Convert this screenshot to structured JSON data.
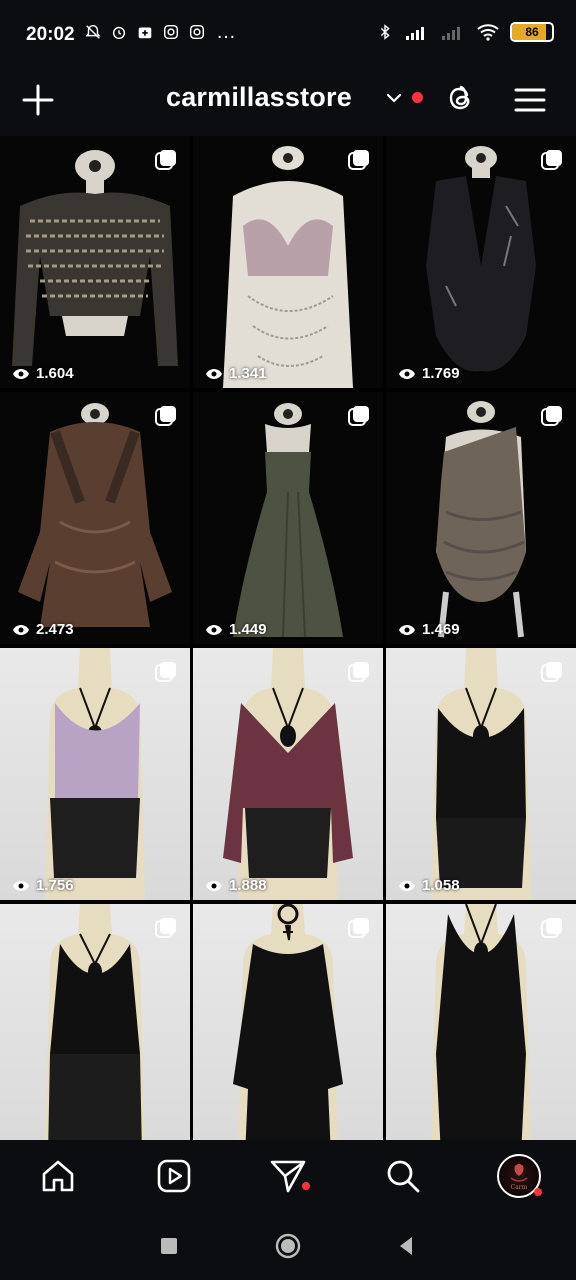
{
  "status_bar": {
    "time": "20:02",
    "more": "…",
    "battery_level": "86",
    "colors": {
      "battery": "#e6a923"
    }
  },
  "header": {
    "account_name": "carmillasstore",
    "accent_color": "#ff3040"
  },
  "posts": [
    {
      "views": "1.604",
      "type": "carousel",
      "background": "dark"
    },
    {
      "views": "1.341",
      "type": "carousel",
      "background": "dark"
    },
    {
      "views": "1.769",
      "type": "carousel",
      "background": "dark"
    },
    {
      "views": "2.473",
      "type": "carousel",
      "background": "dark"
    },
    {
      "views": "1.449",
      "type": "carousel",
      "background": "dark"
    },
    {
      "views": "1.469",
      "type": "carousel",
      "background": "dark"
    },
    {
      "views": "1.756",
      "type": "carousel",
      "background": "light"
    },
    {
      "views": "1.888",
      "type": "carousel",
      "background": "light"
    },
    {
      "views": "1.058",
      "type": "carousel",
      "background": "light"
    },
    {
      "views": "",
      "type": "carousel",
      "background": "light"
    },
    {
      "views": "",
      "type": "carousel",
      "background": "light"
    },
    {
      "views": "",
      "type": "carousel",
      "background": "light"
    }
  ],
  "bottom_nav": {
    "items": [
      "home-icon",
      "reels-icon",
      "direct-message-icon",
      "search-icon",
      "profile-avatar"
    ],
    "avatar_text": "Carm"
  },
  "system_nav": [
    "recents-button",
    "home-button",
    "back-button"
  ]
}
